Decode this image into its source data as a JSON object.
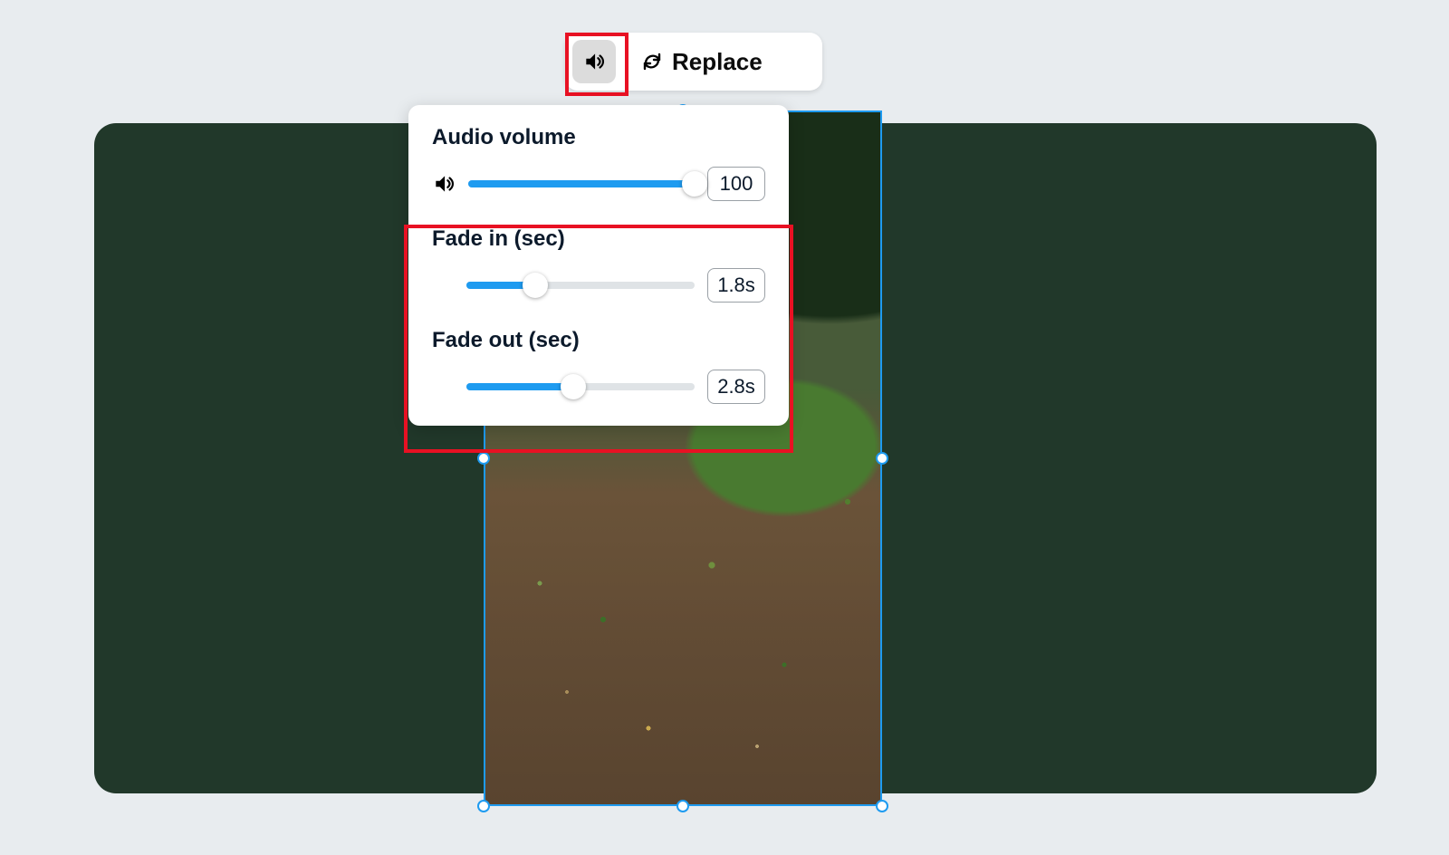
{
  "toolbar": {
    "replace_label": "Replace"
  },
  "panel": {
    "volume": {
      "title": "Audio volume",
      "value": "100",
      "fill_pct": 100
    },
    "fade_in": {
      "title": "Fade in (sec)",
      "value": "1.8s",
      "fill_pct": 30
    },
    "fade_out": {
      "title": "Fade out (sec)",
      "value": "2.8s",
      "fill_pct": 47
    }
  }
}
